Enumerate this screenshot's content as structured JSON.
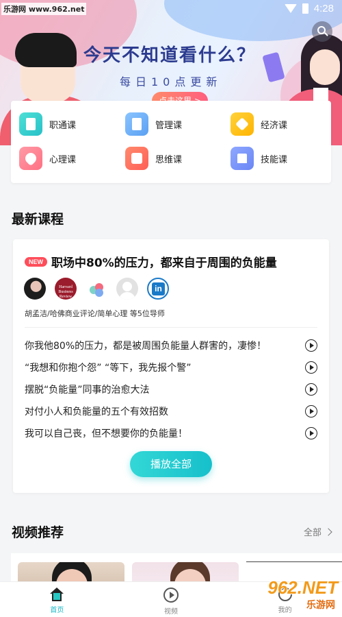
{
  "status_bar": {
    "watermark": "乐游网 www.962.net",
    "time": "4:28"
  },
  "banner": {
    "title": "今天不知道看什么？",
    "subtitle": "每日10点更新",
    "button": "点击这里 >"
  },
  "categories": [
    {
      "label": "职通课",
      "icon": "book-icon",
      "color": "#27c1c8"
    },
    {
      "label": "管理课",
      "icon": "document-icon",
      "color": "#5aa0f2"
    },
    {
      "label": "经济课",
      "icon": "coin-icon",
      "color": "#ffb400"
    },
    {
      "label": "心理课",
      "icon": "heart-icon",
      "color": "#ff7183"
    },
    {
      "label": "思维课",
      "icon": "puzzle-icon",
      "color": "#ff5f56"
    },
    {
      "label": "技能课",
      "icon": "upload-icon",
      "color": "#6a86f5"
    }
  ],
  "latest": {
    "section_title": "最新课程",
    "badge": "NEW",
    "course_title": "职场中80%的压力，都来自于周围的负能量",
    "avatar_text": "Harvard Business Review",
    "mentors": "胡孟洁/哈佛商业评论/简单心理 等5位导师",
    "lessons": [
      "你我他80%的压力，都是被周围负能量人群害的，凄惨！",
      "“我想和你抱个怨” “等下，我先报个警”",
      "摆脱“负能量”同事的治愈大法",
      "对付小人和负能量的五个有效招数",
      "我可以自己丧，但不想要你的负能量！"
    ],
    "play_all": "播放全部"
  },
  "videos": {
    "section_title": "视频推荐",
    "see_all": "全部"
  },
  "nav": {
    "home": "首页",
    "video": "视频",
    "me": "我的"
  },
  "watermark_logo": {
    "main": "962.NET",
    "sub": "乐游网"
  },
  "accent_color": "#1bb9c7"
}
